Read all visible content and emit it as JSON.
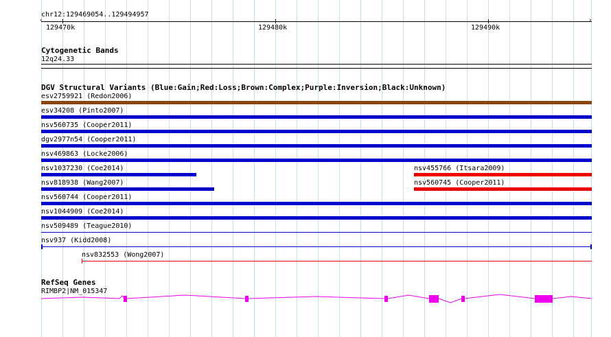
{
  "ruler": {
    "location": "chr12:129469054..129494957",
    "ticks": [
      "129470k",
      "129480k",
      "129490k"
    ]
  },
  "cytoband": {
    "track_title": "Cytogenetic Bands",
    "band": "12q24.33"
  },
  "dgv": {
    "track_title": "DGV Structural Variants (Blue:Gain;Red:Loss;Brown:Complex;Purple:Inversion;Black:Unknown)",
    "colors": {
      "gain": "#0000cc",
      "loss": "#ee0000",
      "complex": "#8b4513"
    },
    "variants": [
      {
        "id": "esv2759921",
        "label": "esv2759921 (Redon2006)",
        "type": "complex"
      },
      {
        "id": "esv34208",
        "label": "esv34208 (Pinto2007)",
        "type": "gain"
      },
      {
        "id": "nsv560735",
        "label": "nsv560735 (Cooper2011)",
        "type": "gain"
      },
      {
        "id": "dgv2977n54",
        "label": "dgv2977n54 (Cooper2011)",
        "type": "gain"
      },
      {
        "id": "nsv469863",
        "label": "nsv469863 (Locke2006)",
        "type": "gain"
      },
      {
        "id": "nsv1037230",
        "label": "nsv1037230 (Coe2014)",
        "type": "gain"
      },
      {
        "id": "nsv455766",
        "label": "nsv455766 (Itsara2009)",
        "type": "loss"
      },
      {
        "id": "nsv818938",
        "label": "nsv818938 (Wang2007)",
        "type": "gain"
      },
      {
        "id": "nsv560745",
        "label": "nsv560745 (Cooper2011)",
        "type": "loss"
      },
      {
        "id": "nsv560744",
        "label": "nsv560744 (Cooper2011)",
        "type": "gain"
      },
      {
        "id": "nsv1044909",
        "label": "nsv1044909 (Coe2014)",
        "type": "gain"
      },
      {
        "id": "nsv509489",
        "label": "nsv509489 (Teague2010)",
        "type": "gain"
      },
      {
        "id": "nsv937",
        "label": "nsv937 (Kidd2008)",
        "type": "gain"
      },
      {
        "id": "nsv832553",
        "label": "nsv832553 (Wong2007)",
        "type": "loss"
      }
    ]
  },
  "refseq": {
    "track_title": "RefSeq Genes",
    "gene_label": "RIMBP2|NM_015347",
    "color": "#ee00ee"
  }
}
